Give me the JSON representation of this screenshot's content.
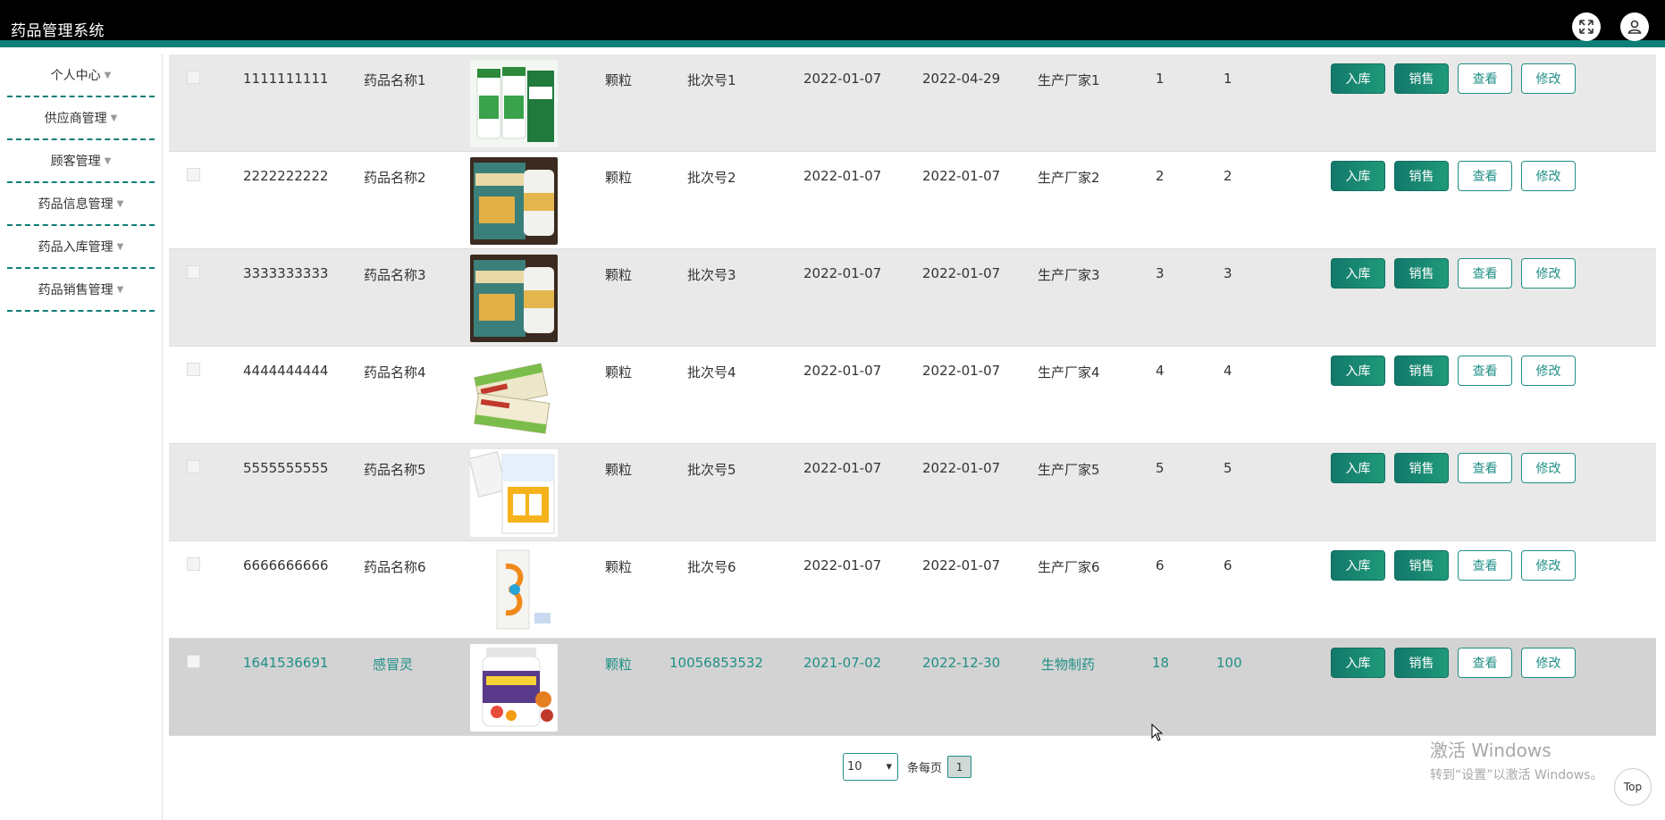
{
  "header": {
    "title": "药品管理系统",
    "fullscreen_icon": "fullscreen-icon",
    "user_icon": "user-icon"
  },
  "sidebar": {
    "items": [
      {
        "label": "个人中心"
      },
      {
        "label": "供应商管理"
      },
      {
        "label": "顾客管理"
      },
      {
        "label": "药品信息管理"
      },
      {
        "label": "药品入库管理"
      },
      {
        "label": "药品销售管理"
      }
    ]
  },
  "actions": {
    "stock_in": "入库",
    "sell": "销售",
    "view": "查看",
    "edit": "修改"
  },
  "rows": [
    {
      "code": "1111111111",
      "name": "药品名称1",
      "form": "颗粒",
      "batch": "批次号1",
      "date1": "2022-01-07",
      "date2": "2022-04-29",
      "maker": "生产厂家1",
      "n1": "1",
      "n2": "1"
    },
    {
      "code": "2222222222",
      "name": "药品名称2",
      "form": "颗粒",
      "batch": "批次号2",
      "date1": "2022-01-07",
      "date2": "2022-01-07",
      "maker": "生产厂家2",
      "n1": "2",
      "n2": "2"
    },
    {
      "code": "3333333333",
      "name": "药品名称3",
      "form": "颗粒",
      "batch": "批次号3",
      "date1": "2022-01-07",
      "date2": "2022-01-07",
      "maker": "生产厂家3",
      "n1": "3",
      "n2": "3"
    },
    {
      "code": "4444444444",
      "name": "药品名称4",
      "form": "颗粒",
      "batch": "批次号4",
      "date1": "2022-01-07",
      "date2": "2022-01-07",
      "maker": "生产厂家4",
      "n1": "4",
      "n2": "4"
    },
    {
      "code": "5555555555",
      "name": "药品名称5",
      "form": "颗粒",
      "batch": "批次号5",
      "date1": "2022-01-07",
      "date2": "2022-01-07",
      "maker": "生产厂家5",
      "n1": "5",
      "n2": "5"
    },
    {
      "code": "6666666666",
      "name": "药品名称6",
      "form": "颗粒",
      "batch": "批次号6",
      "date1": "2022-01-07",
      "date2": "2022-01-07",
      "maker": "生产厂家6",
      "n1": "6",
      "n2": "6"
    },
    {
      "code": "1641536691",
      "name": "感冒灵",
      "form": "颗粒",
      "batch": "10056853532",
      "date1": "2021-07-02",
      "date2": "2022-12-30",
      "maker": "生物制药",
      "n1": "18",
      "n2": "100"
    }
  ],
  "pagination": {
    "page_size": "10",
    "per_page_label": "条每页",
    "current_page": "1"
  },
  "watermark": {
    "title": "激活 Windows",
    "subtitle": "转到“设置”以激活 Windows。"
  },
  "top_button": "Top",
  "colors": {
    "accent": "#1f8f86",
    "header_bg": "#000000"
  }
}
